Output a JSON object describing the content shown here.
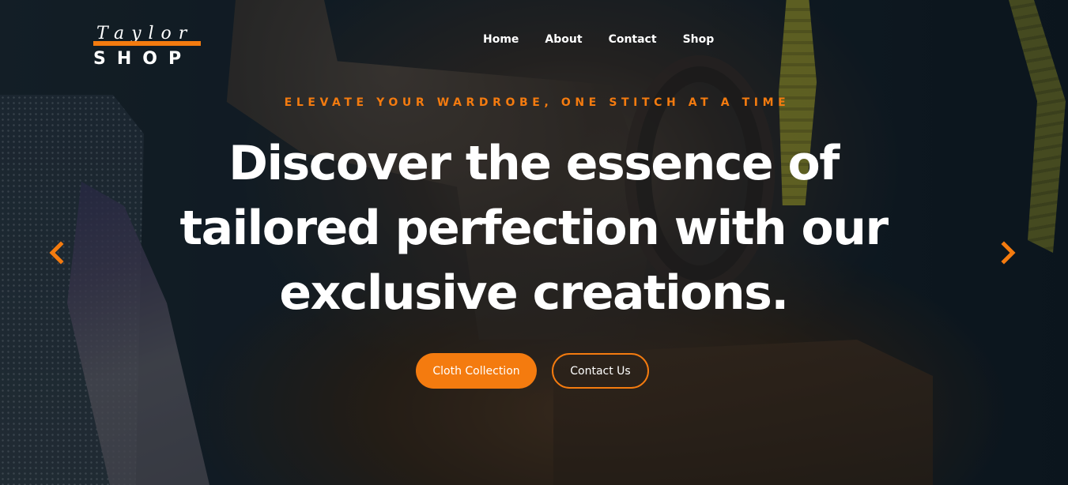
{
  "brand": {
    "script": "Taylor",
    "name": "SHOP",
    "accent_color": "#f47b0f"
  },
  "nav": {
    "items": [
      {
        "label": "Home"
      },
      {
        "label": "About"
      },
      {
        "label": "Contact"
      },
      {
        "label": "Shop"
      }
    ]
  },
  "hero": {
    "tagline": "ELEVATE YOUR WARDROBE, ONE STITCH AT A TIME",
    "headline_lines": [
      "Discover the essence of",
      "tailored perfection with our",
      "exclusive creations."
    ],
    "primary_button": "Cloth Collection",
    "secondary_button": "Contact Us"
  },
  "carousel": {
    "prev_icon": "chevron-left-icon",
    "next_icon": "chevron-right-icon"
  }
}
